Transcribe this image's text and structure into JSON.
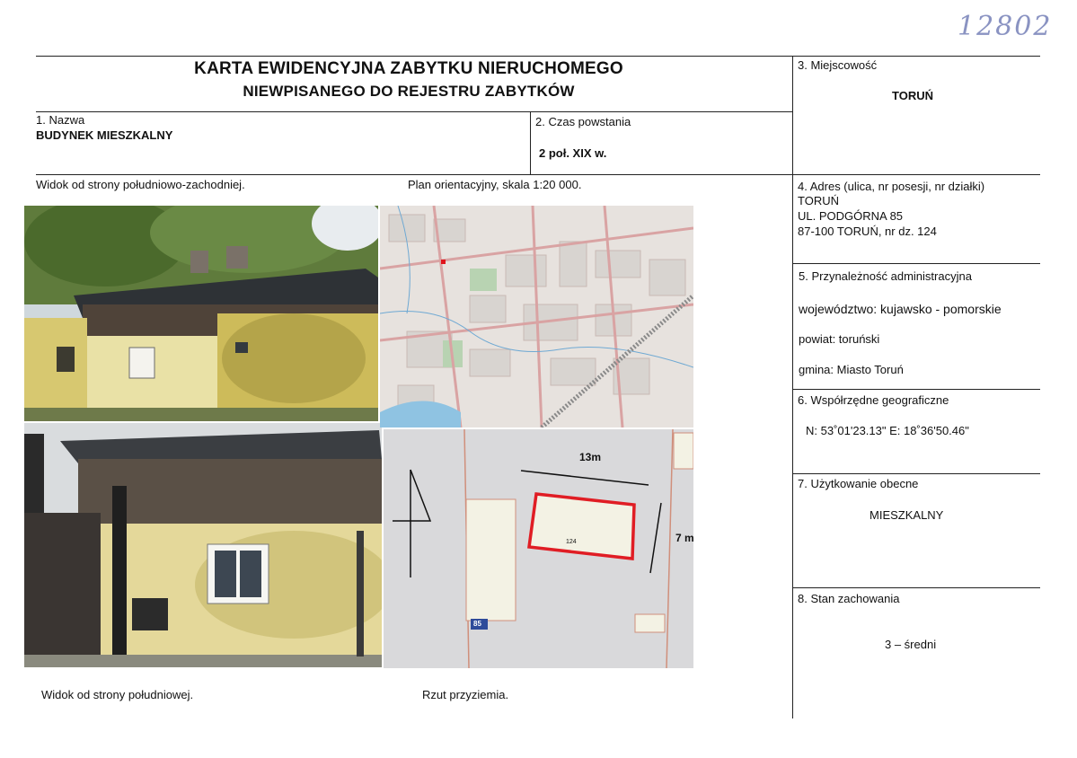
{
  "inventory_number": "12802",
  "header": {
    "title_line1": "KARTA EWIDENCYJNA ZABYTKU NIERUCHOMEGO",
    "title_line2": "NIEWPISANEGO DO REJESTRU ZABYTKÓW"
  },
  "fields": {
    "name_label": "1. Nazwa",
    "name_value": "BUDYNEK MIESZKALNY",
    "date_label": "2. Czas powstania",
    "date_value": "2 poł. XIX w.",
    "locality_label": "3. Miejscowość",
    "locality_value": "TORUŃ",
    "address_label": "4. Adres (ulica, nr posesji, nr działki)",
    "address_line1": "TORUŃ",
    "address_line2": "UL. PODGÓRNA 85",
    "address_line3": "87-100 TORUŃ, nr dz. 124",
    "admin_label": "5. Przynależność administracyjna",
    "voivodeship": "województwo: kujawsko - pomorskie",
    "county": "powiat: toruński",
    "commune": "gmina: Miasto Toruń",
    "coords_label": "6. Współrzędne geograficzne",
    "coords_value": "N: 53˚01'23.13\"  E: 18˚36'50.46\"",
    "use_label": "7. Użytkowanie obecne",
    "use_value": "MIESZKALNY",
    "state_label": "8. Stan zachowania",
    "state_value": "3 – średni"
  },
  "captions": {
    "view_sw": "Widok od strony południowo-zachodniej.",
    "map": "Plan orientacyjny, skala 1:20 000.",
    "view_s": "Widok od strony południowej.",
    "ground_plan": "Rzut przyziemia."
  },
  "plan": {
    "dimension_width": "13m",
    "dimension_depth": "7 m",
    "parcel_number": "124",
    "building_number": "85"
  }
}
